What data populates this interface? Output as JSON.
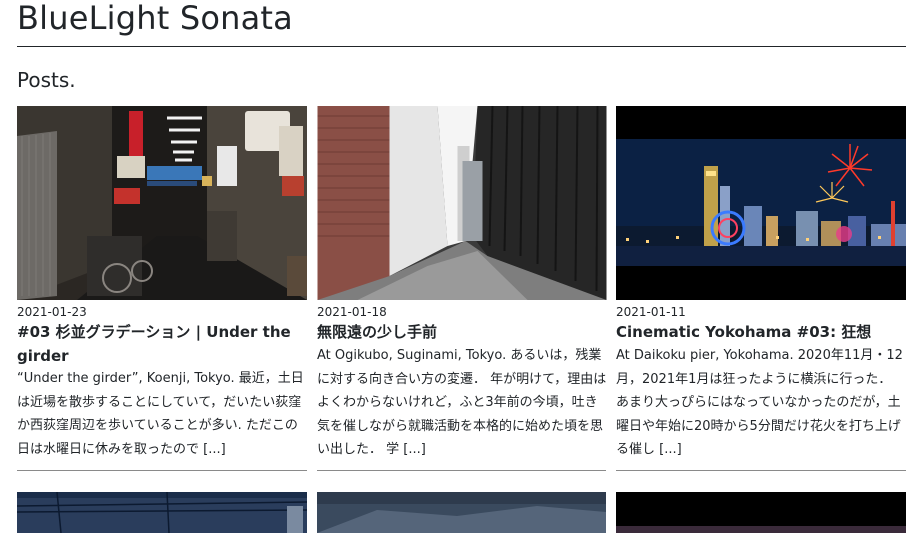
{
  "site": {
    "title": "BlueLight Sonata"
  },
  "section": {
    "heading": "Posts."
  },
  "posts": [
    {
      "date": "2021-01-23",
      "title": "#03 杉並グラデーション | Under the girder",
      "excerpt": "“Under the girder”, Koenji, Tokyo. 最近，土日は近場を散歩することにしていて，だいたい荻窪か西荻窪周辺を歩いていることが多い. ただこの日は水曜日に休みを取ったので",
      "more": "[...]"
    },
    {
      "date": "2021-01-18",
      "title": "無限遠の少し手前",
      "excerpt": "At Ogikubo, Suginami, Tokyo. あるいは，残業に対する向き合い方の変遷． 年が明けて，理由はよくわからないけれど，ふと3年前の今頃，吐き気を催しながら就職活動を本格的に始めた頃を思い出した． 学",
      "more": "[...]"
    },
    {
      "date": "2021-01-11",
      "title": "Cinematic Yokohama #03: 狂想",
      "excerpt": "At Daikoku pier, Yokohama. 2020年11月・12月，2021年1月は狂ったように横浜に行った． あまり大っぴらにはなっていなかったのだが，土曜日や年始に20時から5分間だけ花火を打ち上げる催し",
      "more": "[...]"
    }
  ]
}
